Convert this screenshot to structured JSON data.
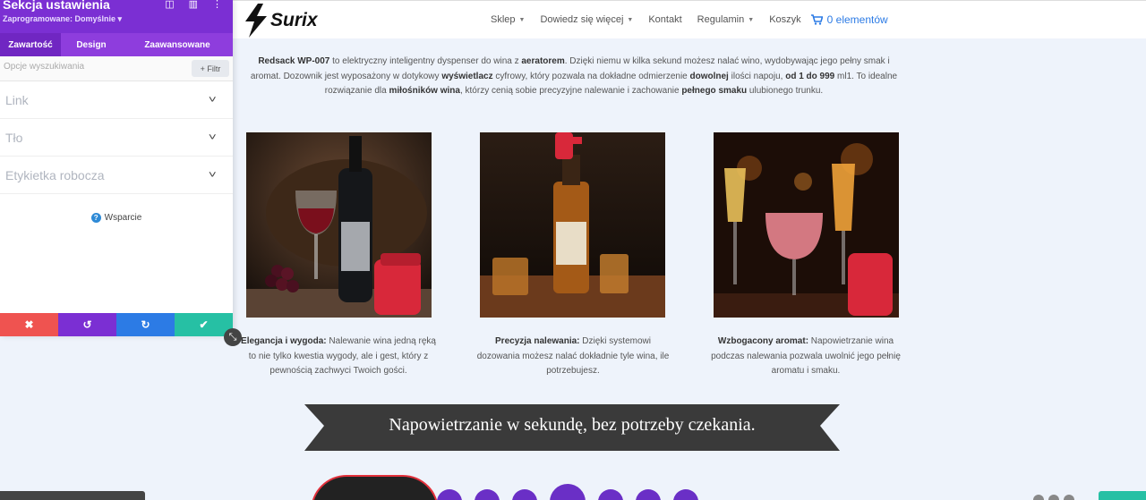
{
  "panel": {
    "title": "Sekcja ustawienia",
    "preset": "Zaprogramowane: Domyślnie ▾",
    "tabs": [
      "Zawartość",
      "Design",
      "Zaawansowane"
    ],
    "search_placeholder": "Opcje wyszukiwania",
    "filter_label": "+ Filtr",
    "accordion": [
      "Link",
      "Tło",
      "Etykietka robocza"
    ],
    "support_label": "Wsparcie",
    "footer_icons": {
      "cancel": "✖",
      "undo": "↺",
      "redo": "↻",
      "save": "✔"
    }
  },
  "header": {
    "logo_text": "Surix",
    "nav": [
      {
        "label": "Sklep",
        "dropdown": true
      },
      {
        "label": "Dowiedz się więcej",
        "dropdown": true
      },
      {
        "label": "Kontakt",
        "dropdown": false
      },
      {
        "label": "Regulamin",
        "dropdown": true
      },
      {
        "label": "Koszyk",
        "dropdown": false
      }
    ],
    "cart_label": "0 elementów"
  },
  "intro": {
    "p1_b1": "Redsack WP-007",
    "p1_t1": " to elektryczny inteligentny dyspenser do wina z ",
    "p1_b2": "aeratorem",
    "p1_t2": ". Dzięki niemu w kilka sekund możesz nalać wino, wydobywając jego pełny smak i aromat. Dozownik jest wyposażony w dotykowy ",
    "p1_b3": "wyświetlacz",
    "p1_t3": " cyfrowy, który pozwala na dokładne odmierzenie ",
    "p1_b4": "dowolnej",
    "p1_t4": " ilości napoju, ",
    "p1_b5": "od 1 do 999",
    "p1_t5": " ml1. To idealne rozwiązanie dla ",
    "p1_b6": "miłośników wina",
    "p1_t6": ", którzy cenią sobie precyzyjne nalewanie i zachowanie ",
    "p1_b7": "pełnego smaku",
    "p1_t7": " ulubionego trunku."
  },
  "cards": [
    {
      "title": "Elegancja i wygoda:",
      "text": " Nalewanie wina jedną ręką to nie tylko kwestia wygody, ale i gest, który z pewnością zachwyci Twoich gości."
    },
    {
      "title": "Precyzja nalewania:",
      "text": " Dzięki systemowi dozowania możesz nalać dokładnie tyle wina, ile potrzebujesz."
    },
    {
      "title": "Wzbogacony aromat:",
      "text": " Napowietrzanie wina podczas nalewania pozwala uwolnić jego pełnię aromatu i smaku."
    }
  ],
  "banner_text": "Napowietrzanie w sekundę, bez potrzeby czekania.",
  "colors": {
    "accent": "#7b2fd3",
    "cart": "#2c7be5",
    "banner": "#3a3a3a",
    "dispenser_red": "#d8283a"
  }
}
